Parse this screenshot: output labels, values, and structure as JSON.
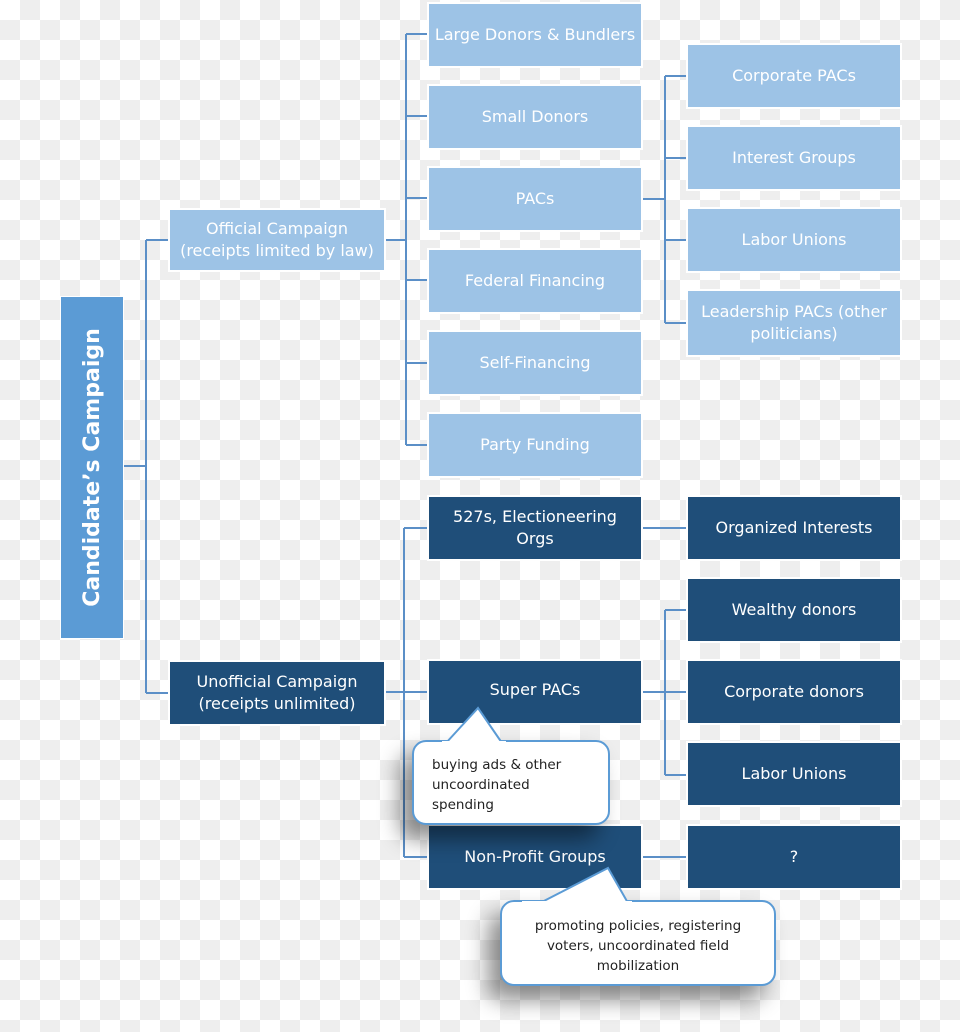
{
  "diagram": {
    "root": {
      "label": "Candidate’s Campaign"
    },
    "official": {
      "label_line1": "Official Campaign",
      "label_line2": "(receipts limited by law)",
      "sources": [
        {
          "label": "Large Donors & Bundlers"
        },
        {
          "label": "Small Donors"
        },
        {
          "label": "PACs"
        },
        {
          "label": "Federal Financing"
        },
        {
          "label": "Self-Financing"
        },
        {
          "label": "Party Funding"
        }
      ],
      "pac_sources": [
        {
          "label": "Corporate PACs"
        },
        {
          "label": "Interest Groups"
        },
        {
          "label": "Labor Unions"
        },
        {
          "label": "Leadership PACs (other politicians)"
        }
      ]
    },
    "unofficial": {
      "label_line1": "Unofficial Campaign",
      "label_line2": "(receipts unlimited)",
      "sources": [
        {
          "label": "527s, Electioneering Orgs"
        },
        {
          "label": "Super PACs"
        },
        {
          "label": "Non-Profit Groups"
        }
      ],
      "org527_sources": [
        {
          "label": "Organized Interests"
        }
      ],
      "superpac_sources": [
        {
          "label": "Wealthy donors"
        },
        {
          "label": "Corporate donors"
        },
        {
          "label": "Labor Unions"
        }
      ],
      "nonprofit_sources": [
        {
          "label": "?"
        }
      ]
    },
    "callouts": {
      "superpac_note": "buying ads & other uncoordinated spending",
      "nonprofit_note": "promoting policies, registering voters, uncoordinated field mobilization"
    },
    "colors": {
      "root": "#5b9bd5",
      "official": "#9dc3e6",
      "unofficial": "#1f4e79",
      "connector": "#5b8fc7"
    }
  }
}
